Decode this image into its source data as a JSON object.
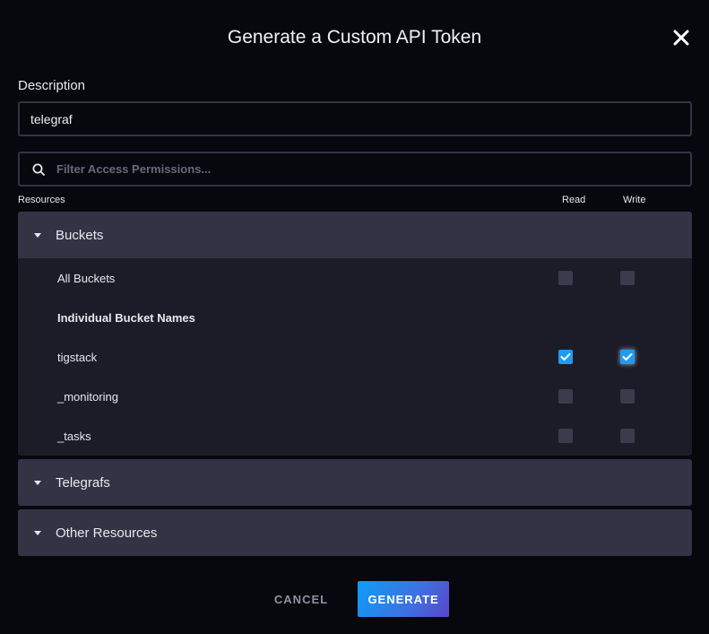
{
  "dialog": {
    "title": "Generate a Custom API Token",
    "close_icon": "close-icon"
  },
  "description": {
    "label": "Description",
    "value": "telegraf"
  },
  "filter": {
    "placeholder": "Filter Access Permissions...",
    "icon": "search-icon"
  },
  "columns": {
    "resources": "Resources",
    "read": "Read",
    "write": "Write"
  },
  "sections": [
    {
      "title": "Buckets",
      "expanded": true,
      "rows": [
        {
          "label": "All Buckets",
          "read": false,
          "write": false
        },
        {
          "label": "Individual Bucket Names",
          "heading": true
        },
        {
          "label": "tigstack",
          "read": true,
          "write": true
        },
        {
          "label": "_monitoring",
          "read": false,
          "write": false
        },
        {
          "label": "_tasks",
          "read": false,
          "write": false
        }
      ]
    },
    {
      "title": "Telegrafs",
      "expanded": false
    },
    {
      "title": "Other Resources",
      "expanded": false
    }
  ],
  "footer": {
    "cancel_label": "CANCEL",
    "generate_label": "GENERATE"
  },
  "colors": {
    "accent_checkbox": "#1e9cf2",
    "generate_gradient_start": "#0e9ef5",
    "generate_gradient_end": "#5a46cc",
    "section_header": "#333346",
    "section_body": "#1c1c29"
  }
}
